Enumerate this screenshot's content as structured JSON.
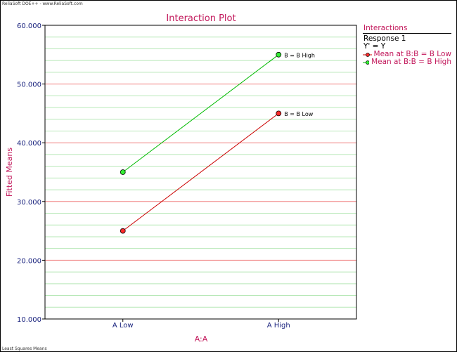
{
  "header_note": "ReliaSoft DOE++ - www.ReliaSoft.com",
  "footer_note": "Least Squares Means",
  "legend": {
    "title": "Interactions",
    "response": "Response 1",
    "equation": "Y' = Y",
    "entries": [
      {
        "label": "Mean at B:B = B Low",
        "color": "#cc0000"
      },
      {
        "label": "Mean at B:B = B High",
        "color": "#00bb00"
      }
    ]
  },
  "chart_data": {
    "type": "line",
    "title": "Interaction Plot",
    "xlabel": "A:A",
    "ylabel": "Fitted Means",
    "categories": [
      "A Low",
      "A High"
    ],
    "ylim": [
      10,
      60
    ],
    "yticks": [
      "10.000",
      "20.000",
      "30.000",
      "40.000",
      "50.000",
      "60.000"
    ],
    "series": [
      {
        "name": "B = B Low",
        "values": [
          25,
          45
        ],
        "color": "#cc0000",
        "point_color": "#ff2a2a"
      },
      {
        "name": "B = B High",
        "values": [
          35,
          55
        ],
        "color": "#00bb00",
        "point_color": "#33ee33"
      }
    ],
    "colors": {
      "title": "#c2185b",
      "axis_label": "#c2185b",
      "tick_label": "#1a237e",
      "major_grid": "#f08080",
      "minor_grid": "#b7e8b7"
    },
    "grid": true,
    "legend_position": "right"
  }
}
